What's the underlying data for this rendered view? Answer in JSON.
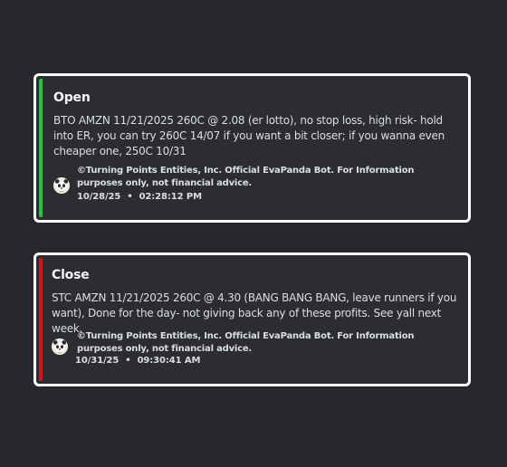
{
  "embeds": [
    {
      "title": "Open",
      "accent_color": "#22c33a",
      "description": "BTO AMZN 11/21/2025 260C @ 2.08 (er lotto), no stop loss, high risk- hold into ER, you can try 260C 14/07 if you want a bit closer; if you wanna even cheaper one, 250C 10/31",
      "footer": {
        "avatar_icon": "panda-avatar-icon",
        "text": "©Turning Points Entities, Inc. Official EvaPanda Bot. For Information purposes only, not financial advice.",
        "date": "10/28/25",
        "separator": "•",
        "time": "02:28:12 PM"
      }
    },
    {
      "title": "Close",
      "accent_color": "#d0151a",
      "description": "STC AMZN 11/21/2025 260C @ 4.30 (BANG BANG BANG, leave runners if you want), Done for the day- not giving back any of these profits. See yall next week.",
      "footer": {
        "avatar_icon": "panda-avatar-icon",
        "text": "©Turning Points Entities, Inc. Official EvaPanda Bot. For Information purposes only, not financial advice.",
        "date": "10/31/25",
        "separator": "•",
        "time": "09:30:41 AM"
      }
    }
  ]
}
